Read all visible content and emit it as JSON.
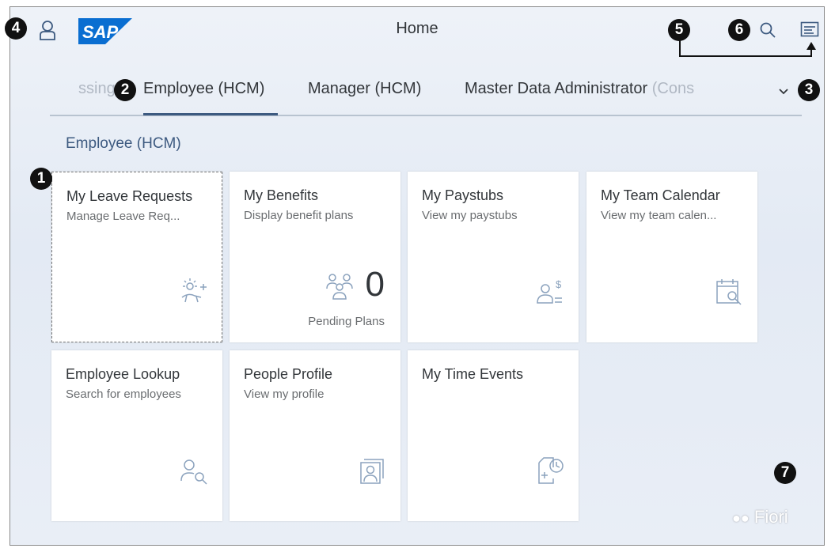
{
  "shell": {
    "title": "Home",
    "logo_text": "SAP",
    "brand_color": "#0a6ed1"
  },
  "tabs": [
    {
      "label": "Processing",
      "visible_text": "ssing"
    },
    {
      "label": "Employee (HCM)"
    },
    {
      "label": "Manager (HCM)"
    },
    {
      "label": "Master Data Administrator",
      "faded_suffix": "(Cons"
    }
  ],
  "active_tab": "Employee (HCM)",
  "section": {
    "title": "Employee (HCM)"
  },
  "tiles": [
    {
      "title": "My Leave Requests",
      "subtitle": "Manage Leave Req...",
      "icon": "leave-icon"
    },
    {
      "title": "My Benefits",
      "subtitle": "Display benefit plans",
      "icon": "people-group-icon",
      "kpi": "0",
      "kpi_label": "Pending Plans"
    },
    {
      "title": "My Paystubs",
      "subtitle": "View my paystubs",
      "icon": "person-money-icon"
    },
    {
      "title": "My Team Calendar",
      "subtitle": "View my team calen...",
      "icon": "calendar-search-icon"
    },
    {
      "title": "Employee Lookup",
      "subtitle": "Search for employees",
      "icon": "person-search-icon"
    },
    {
      "title": "People Profile",
      "subtitle": "View my profile",
      "icon": "profile-card-icon"
    },
    {
      "title": "My Time Events",
      "subtitle": "",
      "icon": "time-event-icon"
    }
  ],
  "callouts": [
    "1",
    "2",
    "3",
    "4",
    "5",
    "6",
    "7"
  ],
  "watermark": "Fiori"
}
